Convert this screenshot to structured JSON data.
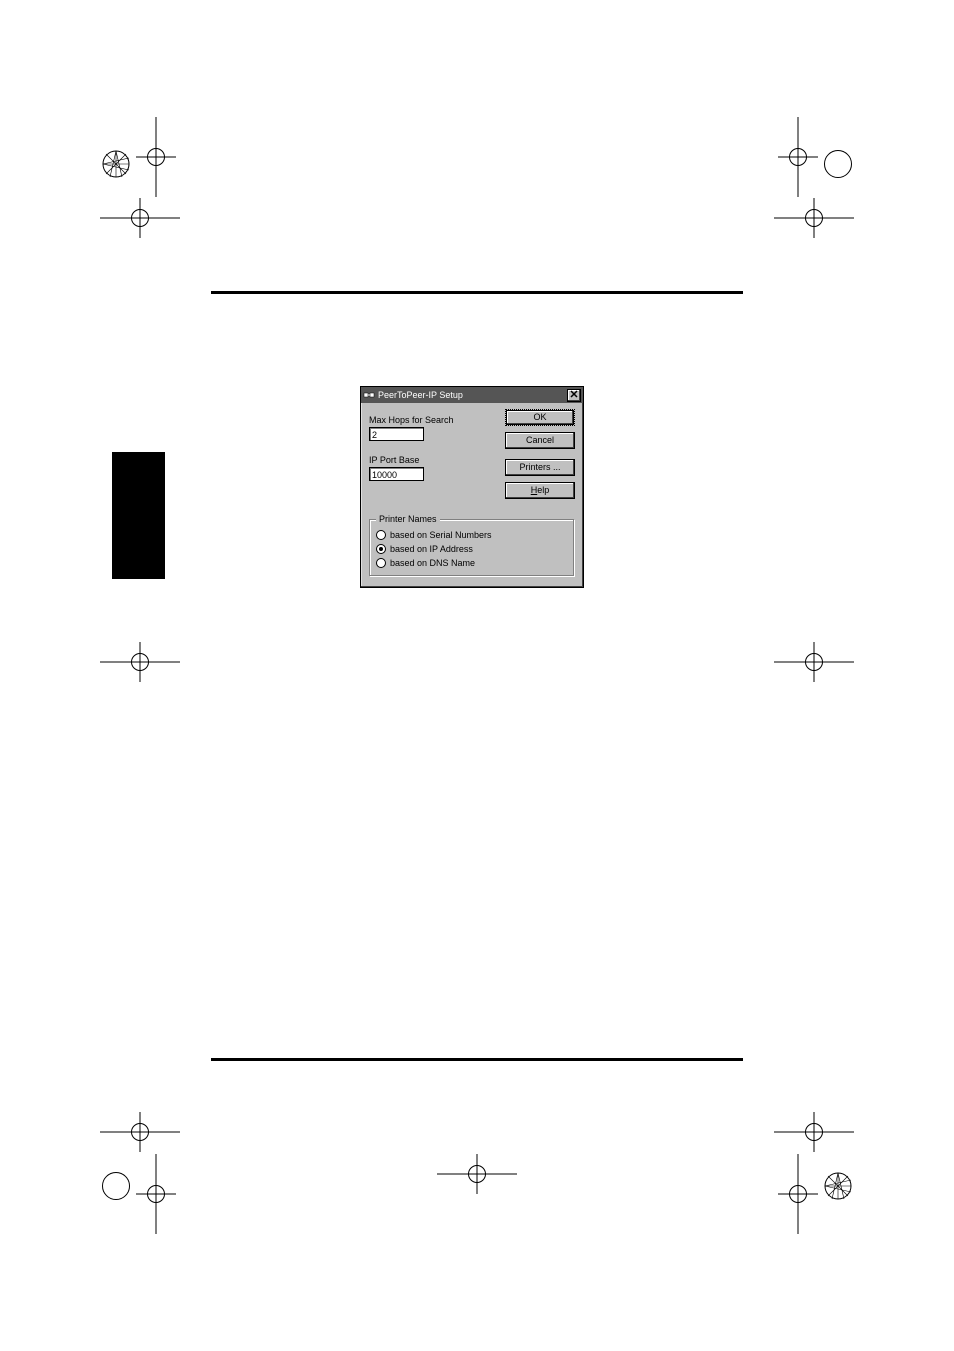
{
  "dialog": {
    "title": "PeerToPeer-IP Setup",
    "labels": {
      "max_hops": "Max Hops for Search",
      "ip_port_base": "IP Port Base"
    },
    "fields": {
      "max_hops_value": "2",
      "ip_port_base_value": "10000"
    },
    "buttons": {
      "ok": "OK",
      "cancel": "Cancel",
      "printers": "Printers ...",
      "help_prefix": "H",
      "help_rest": "elp"
    },
    "group": {
      "legend": "Printer Names",
      "options": [
        {
          "label": "based on Serial Numbers",
          "selected": false
        },
        {
          "label": "based on IP Address",
          "selected": true
        },
        {
          "label": "based on DNS Name",
          "selected": false
        }
      ]
    }
  }
}
